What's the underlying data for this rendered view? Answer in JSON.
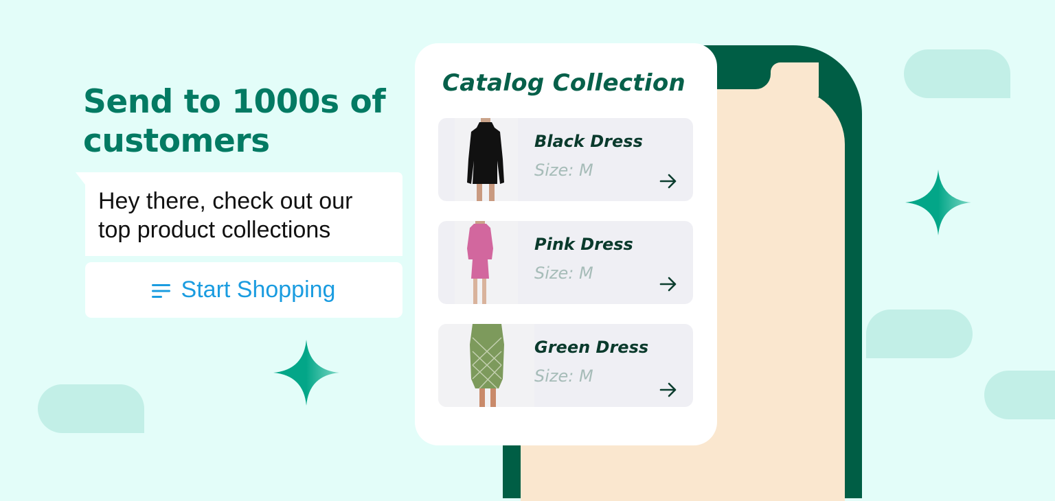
{
  "hero": {
    "headline": "Send to 1000s of customers"
  },
  "message": {
    "lines": [
      "Hey there, check out our",
      "top product collections"
    ]
  },
  "cta": {
    "label": "Start Shopping",
    "icon": "list-icon",
    "color": "#1a9ce0"
  },
  "catalog": {
    "title": "Catalog Collection",
    "products": [
      {
        "name": "Black Dress",
        "size": "Size: M",
        "dress_color": "#111111"
      },
      {
        "name": "Pink Dress",
        "size": "Size: M",
        "dress_color": "#d2679e"
      },
      {
        "name": "Green Dress",
        "size": "Size: M",
        "dress_color": "#7d9a5c"
      }
    ]
  },
  "colors": {
    "background": "#e3fdf9",
    "brand_green": "#037a63",
    "phone_frame": "#005e45",
    "phone_screen": "#fae7cf",
    "sparkle": "#03a688",
    "deco_bubble": "#c2efe7"
  }
}
